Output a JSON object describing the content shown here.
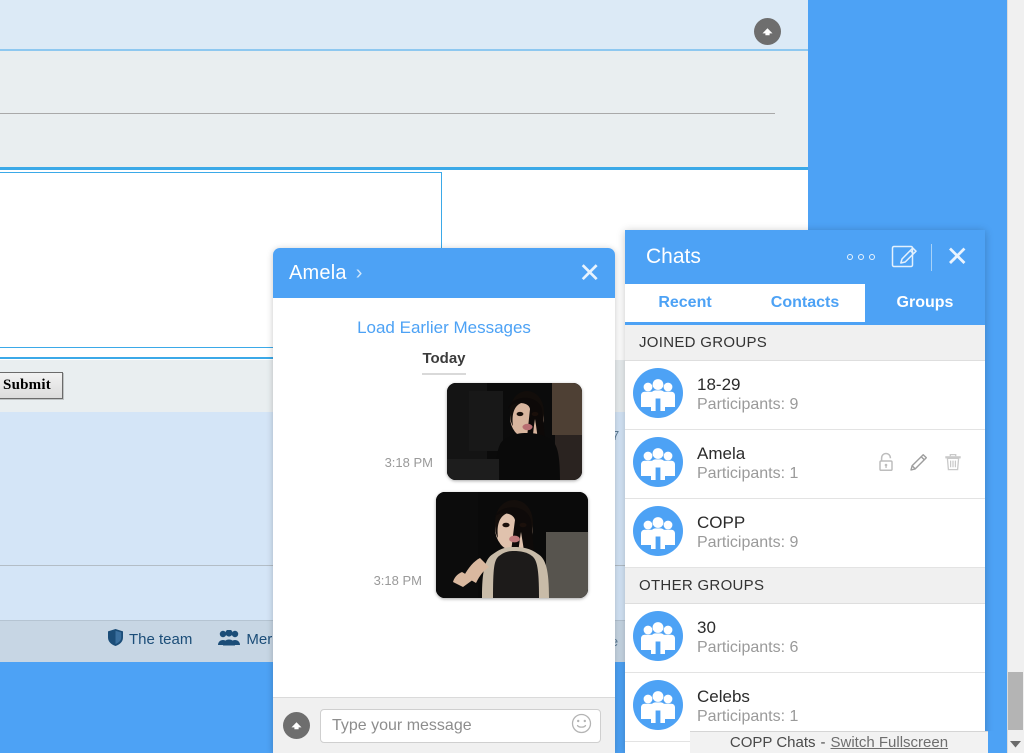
{
  "colors": {
    "brand_blue": "#4da2f5",
    "light_blue_bg": "#d4e5f7",
    "panel_grey": "#e9eef0",
    "footer_bar": "#c7d6e4"
  },
  "background_page": {
    "submit_button": "Submit",
    "footer_links": [
      {
        "icon": "shield-icon",
        "label": "The team"
      },
      {
        "icon": "members-icon",
        "label": "Mer"
      }
    ],
    "fragments": [
      {
        "text": "7"
      },
      {
        "text": "ie"
      }
    ],
    "scroll_top_icon": "chevron-up-circle-icon"
  },
  "chat_window": {
    "title": "Amela",
    "caret_icon": "chevron-right-icon",
    "close_icon": "close-icon",
    "load_earlier": "Load Earlier Messages",
    "day_divider": "Today",
    "messages": [
      {
        "time": "3:18 PM",
        "type": "photo",
        "photo_name": "photo-woman-dark-hair-car"
      },
      {
        "time": "3:18 PM",
        "type": "photo",
        "photo_name": "photo-woman-selfie"
      }
    ],
    "composer": {
      "scroll_up_icon": "chevron-up-circle-icon",
      "placeholder": "Type your message",
      "value": "",
      "emoji_icon": "smiley-icon"
    }
  },
  "chats_panel": {
    "title": "Chats",
    "more_icon": "more-options-icon",
    "compose_icon": "compose-icon",
    "close_icon": "close-icon",
    "tabs": [
      {
        "label": "Recent",
        "active": false
      },
      {
        "label": "Contacts",
        "active": false
      },
      {
        "label": "Groups",
        "active": true
      }
    ],
    "sections": [
      {
        "header": "JOINED GROUPS",
        "groups": [
          {
            "name": "18-29",
            "participants": "Participants: 9",
            "icon": "group-icon",
            "actions": []
          },
          {
            "name": "Amela",
            "participants": "Participants: 1",
            "icon": "group-icon",
            "actions": [
              "lock-icon",
              "edit-icon",
              "trash-icon"
            ]
          },
          {
            "name": "COPP",
            "participants": "Participants: 9",
            "icon": "group-icon",
            "actions": []
          }
        ]
      },
      {
        "header": "OTHER GROUPS",
        "groups": [
          {
            "name": "30",
            "participants": "Participants: 6",
            "icon": "group-icon",
            "actions": []
          },
          {
            "name": "Celebs",
            "participants": "Participants: 1",
            "icon": "group-icon",
            "actions": []
          }
        ]
      }
    ]
  },
  "status_bar": {
    "title": "COPP Chats",
    "separator": "-",
    "link": "Switch Fullscreen"
  }
}
